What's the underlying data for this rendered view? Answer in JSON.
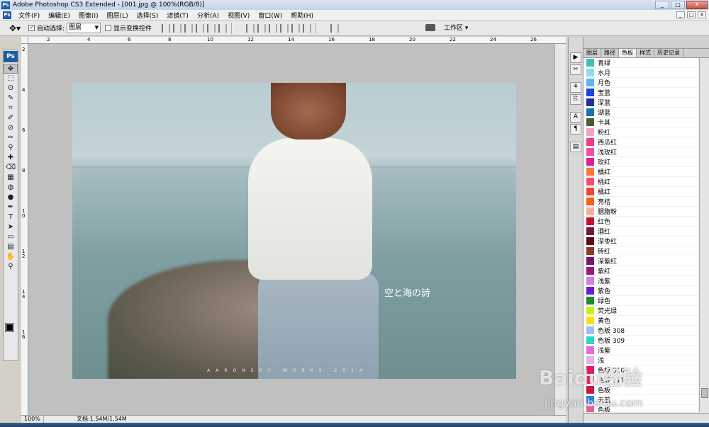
{
  "window": {
    "title": "Adobe Photoshop CS3 Extended - [001.jpg @ 100%(RGB/8)]",
    "app_icon": "Ps",
    "controls": [
      "_",
      "□",
      "X"
    ]
  },
  "menubar": {
    "items": [
      "文件(F)",
      "编辑(E)",
      "图像(I)",
      "图层(L)",
      "选择(S)",
      "滤镜(T)",
      "分析(A)",
      "视图(V)",
      "窗口(W)",
      "帮助(H)"
    ]
  },
  "options": {
    "auto_select_label": "自动选择:",
    "auto_select_value": "图层",
    "show_transform_label": "显示变换控件",
    "workspace_label": "工作区 ▾"
  },
  "toolbox": {
    "logo": "Ps",
    "tools": [
      "✥",
      "⬚",
      "ʘ",
      "✎",
      "⌗",
      "✐",
      "⊘",
      "✑",
      "⚲",
      "✚",
      "⌫",
      "▦",
      "◍",
      "●",
      "✒",
      "T",
      "➤",
      "▭",
      "▤",
      "✋",
      "⚲"
    ]
  },
  "ruler": {
    "h_labels": [
      "2",
      "4",
      "6",
      "8",
      "10",
      "12",
      "14",
      "16",
      "18",
      "20",
      "22",
      "24",
      "26"
    ],
    "v_labels": [
      "2",
      "4",
      "6",
      "8",
      "10",
      "12",
      "14",
      "16"
    ]
  },
  "photo": {
    "caption": "空と海の詩",
    "watermark": "AARONSKY WORKS 2014"
  },
  "status": {
    "zoom": "100%",
    "doc": "文档:1.54M/1.54M"
  },
  "panel": {
    "tabs": [
      "图层",
      "路径",
      "色板",
      "样式",
      "历史记录"
    ],
    "active_tab": "色板",
    "swatches": [
      {
        "name": "青绿",
        "color": "#3fc1b6"
      },
      {
        "name": "水月",
        "color": "#8fdcf0"
      },
      {
        "name": "月色",
        "color": "#5ab8ee"
      },
      {
        "name": "宝蓝",
        "color": "#1f3fe0"
      },
      {
        "name": "深蓝",
        "color": "#1e2f9c"
      },
      {
        "name": "湖蓝",
        "color": "#1e6fb8"
      },
      {
        "name": "卡其",
        "color": "#4b5b3a"
      },
      {
        "name": "粉红",
        "color": "#f5a0c8"
      },
      {
        "name": "西瓜红",
        "color": "#f0407c"
      },
      {
        "name": "浅玫红",
        "color": "#ef4fa0"
      },
      {
        "name": "玫红",
        "color": "#e21d8c"
      },
      {
        "name": "橘红",
        "color": "#f7783a"
      },
      {
        "name": "桃红",
        "color": "#f54d6e"
      },
      {
        "name": "橘红",
        "color": "#ef4536"
      },
      {
        "name": "亮桔",
        "color": "#f7600d"
      },
      {
        "name": "胭脂粉",
        "color": "#f5b09a"
      },
      {
        "name": "红色",
        "color": "#c8102e"
      },
      {
        "name": "酒红",
        "color": "#721739"
      },
      {
        "name": "深枣红",
        "color": "#5c0d1a"
      },
      {
        "name": "砖红",
        "color": "#8c3d1f"
      },
      {
        "name": "深紫红",
        "color": "#7a1473"
      },
      {
        "name": "紫红",
        "color": "#a0147e"
      },
      {
        "name": "浅紫",
        "color": "#d37be6"
      },
      {
        "name": "紫色",
        "color": "#6a1cd6"
      },
      {
        "name": "绿色",
        "color": "#1f8a2f"
      },
      {
        "name": "荧光绿",
        "color": "#c8f018"
      },
      {
        "name": "黄色",
        "color": "#f5e214"
      },
      {
        "name": "色板 308",
        "color": "#9dbfef"
      },
      {
        "name": "色板 309",
        "color": "#2fd7c0"
      },
      {
        "name": "浅紫",
        "color": "#e36ddf"
      },
      {
        "name": "浅",
        "color": "#e5b4ea"
      },
      {
        "name": "色板 310",
        "color": "#e8195e"
      },
      {
        "name": "色板 311",
        "color": "#ec1a6d"
      },
      {
        "name": "色板",
        "color": "#c9163f"
      },
      {
        "name": "天蓝",
        "color": "#2f7ee8"
      },
      {
        "name": "色板",
        "color": "#e35f9a"
      }
    ]
  },
  "site_watermark": {
    "logo": "Baidu经验",
    "url": "jingyan.baidu.com"
  }
}
